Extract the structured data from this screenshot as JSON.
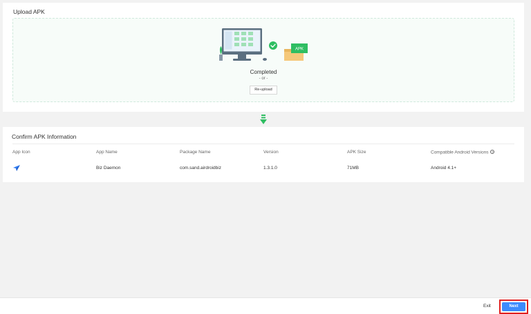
{
  "upload": {
    "title": "Upload APK",
    "badge": "APK",
    "status": "Completed",
    "or_text": "- or -",
    "reupload_label": "Re-upload"
  },
  "confirm": {
    "title": "Confirm APK Information",
    "headers": [
      "App Icon",
      "App Name",
      "Package Name",
      "Version",
      "APK Size",
      "Compatible Android Versions"
    ],
    "row": {
      "app_icon": "paper-plane-icon",
      "app_name": "Biz Daemon",
      "package_name": "com.sand.airdroidbiz",
      "version": "1.3.1.0",
      "apk_size": "71MB",
      "android_versions": "Android 4.1+"
    }
  },
  "footer": {
    "exit_label": "Exit",
    "next_label": "Next"
  },
  "colors": {
    "accent_green": "#2fbe62",
    "primary_blue": "#3d8bfd",
    "highlight_red": "#e02020"
  }
}
